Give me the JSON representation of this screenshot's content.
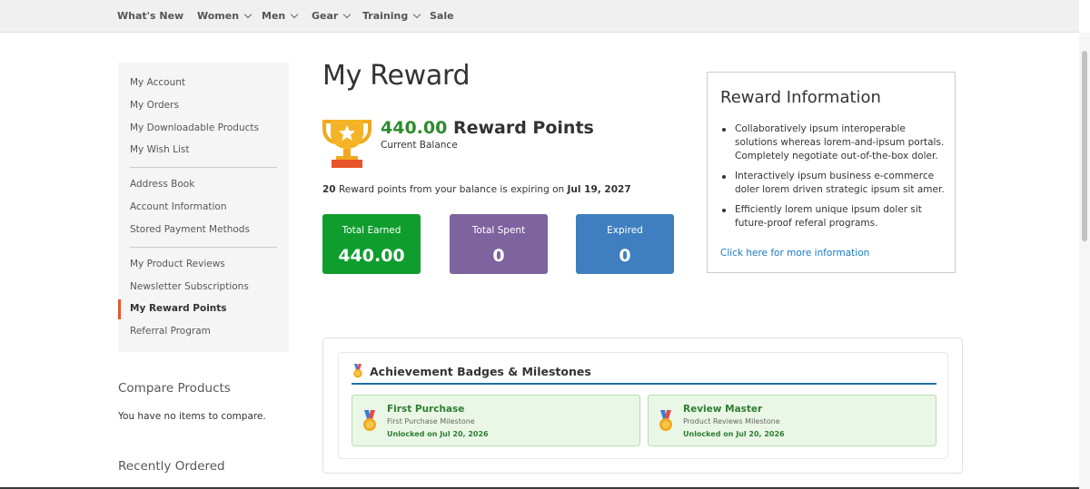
{
  "nav": {
    "items": [
      {
        "label": "What's New",
        "dropdown": false
      },
      {
        "label": "Women",
        "dropdown": true
      },
      {
        "label": "Men",
        "dropdown": true
      },
      {
        "label": "Gear",
        "dropdown": true
      },
      {
        "label": "Training",
        "dropdown": true
      },
      {
        "label": "Sale",
        "dropdown": false
      }
    ]
  },
  "sidebar": {
    "groups": [
      [
        "My Account",
        "My Orders",
        "My Downloadable Products",
        "My Wish List"
      ],
      [
        "Address Book",
        "Account Information",
        "Stored Payment Methods"
      ],
      [
        "My Product Reviews",
        "Newsletter Subscriptions",
        "My Reward Points",
        "Referral Program"
      ]
    ],
    "active": "My Reward Points",
    "accent_color": "#e8542a"
  },
  "compare": {
    "title": "Compare Products",
    "empty_text": "You have no items to compare."
  },
  "recently_ordered": {
    "title": "Recently Ordered"
  },
  "main": {
    "title": "My Reward",
    "balance": {
      "points": "440.00",
      "unit": "Reward Points",
      "caption": "Current Balance",
      "icon": "trophy-icon"
    },
    "expiry": {
      "count": "20",
      "text": "Reward points from your balance is expiring on",
      "date": "Jul 19, 2027"
    },
    "stats": [
      {
        "label": "Total Earned",
        "value": "440.00",
        "color": "#0f9d2e"
      },
      {
        "label": "Total Spent",
        "value": "0",
        "color": "#7e639f"
      },
      {
        "label": "Expired",
        "value": "0",
        "color": "#3f7fbf"
      }
    ]
  },
  "reward_info": {
    "title": "Reward Information",
    "items": [
      "Collaboratively ipsum interoperable solutions whereas lorem-and-ipsum portals. Completely negotiate out-of-the-box doler.",
      "Interactively ipsum business e-commerce doler lorem driven strategic ipsum sit amer.",
      "Efficiently lorem unique ipsum doler sit future-proof referal programs."
    ],
    "link": "Click here for more information",
    "link_color": "#1979c3"
  },
  "achievements": {
    "title": "Achievement Badges & Milestones",
    "icon": "medal-icon",
    "badges": [
      {
        "title": "First Purchase",
        "subtitle": "First Purchase Milestone",
        "date": "Unlocked on Jul 20, 2026"
      },
      {
        "title": "Review Master",
        "subtitle": "Product Reviews Milestone",
        "date": "Unlocked on Jul 20, 2026"
      }
    ]
  }
}
